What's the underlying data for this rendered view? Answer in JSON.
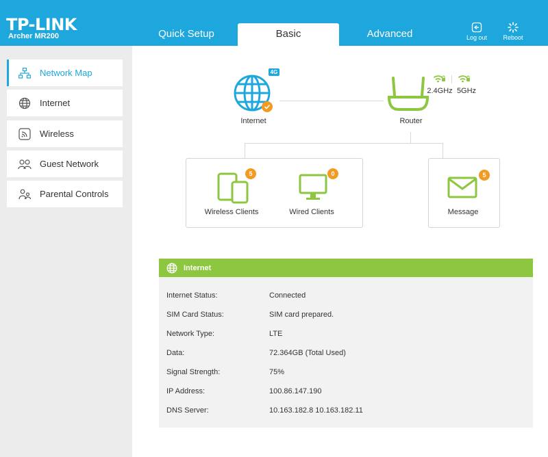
{
  "header": {
    "logo": "TP-LINK",
    "model": "Archer MR200",
    "tabs": [
      {
        "label": "Quick Setup"
      },
      {
        "label": "Basic"
      },
      {
        "label": "Advanced"
      }
    ],
    "logout_label": "Log out",
    "reboot_label": "Reboot"
  },
  "sidebar": {
    "items": [
      {
        "label": "Network Map",
        "icon": "network-map-icon"
      },
      {
        "label": "Internet",
        "icon": "globe-icon"
      },
      {
        "label": "Wireless",
        "icon": "wireless-icon"
      },
      {
        "label": "Guest Network",
        "icon": "guest-network-icon"
      },
      {
        "label": "Parental Controls",
        "icon": "parental-controls-icon"
      }
    ]
  },
  "network_map": {
    "internet_label": "Internet",
    "tag_4g": "4G",
    "router_label": "Router",
    "band_24": "2.4GHz",
    "band_5": "5GHz",
    "wireless_clients_label": "Wireless Clients",
    "wireless_clients_count": "5",
    "wired_clients_label": "Wired Clients",
    "wired_clients_count": "0",
    "message_label": "Message",
    "message_count": "5"
  },
  "internet_panel": {
    "title": "Internet",
    "rows": [
      {
        "label": "Internet Status:",
        "value": "Connected"
      },
      {
        "label": "SIM Card Status:",
        "value": "SIM card prepared."
      },
      {
        "label": "Network Type:",
        "value": "LTE"
      },
      {
        "label": "Data:",
        "value": "72.364GB (Total Used)"
      },
      {
        "label": "Signal Strength:",
        "value": "75%"
      },
      {
        "label": "IP Address:",
        "value": "100.86.147.190"
      },
      {
        "label": "DNS Server:",
        "value": "10.163.182.8 10.163.182.11"
      }
    ]
  },
  "colors": {
    "brand_blue": "#1ea7dd",
    "accent_green": "#8dc63f",
    "badge_orange": "#f29b24"
  }
}
